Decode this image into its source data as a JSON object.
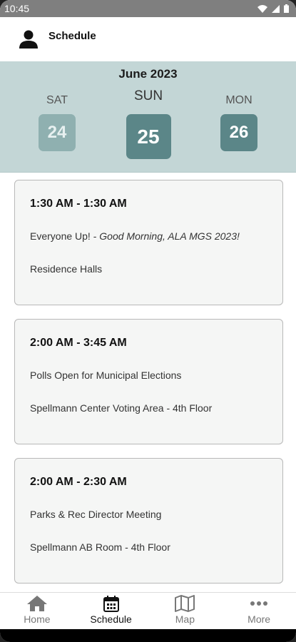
{
  "status": {
    "time": "10:45"
  },
  "header": {
    "title": "Schedule"
  },
  "dates": {
    "month": "June 2023",
    "days": [
      {
        "name": "SAT",
        "num": "24"
      },
      {
        "name": "SUN",
        "num": "25"
      },
      {
        "name": "MON",
        "num": "26"
      }
    ]
  },
  "events": [
    {
      "time": "1:30 AM - 1:30 AM",
      "name_prefix": "Everyone Up! - ",
      "name_italic": "Good Morning, ALA MGS 2023!",
      "location": "Residence Halls"
    },
    {
      "time": "2:00 AM - 3:45 AM",
      "name_prefix": "Polls Open for Municipal Elections",
      "name_italic": "",
      "location": "Spellmann Center Voting Area - 4th Floor"
    },
    {
      "time": "2:00 AM - 2:30 AM",
      "name_prefix": "Parks & Rec Director Meeting",
      "name_italic": "",
      "location": "Spellmann AB Room - 4th Floor"
    }
  ],
  "nav": {
    "items": [
      {
        "label": "Home",
        "icon": "home-icon"
      },
      {
        "label": "Schedule",
        "icon": "calendar-icon"
      },
      {
        "label": "Map",
        "icon": "map-icon"
      },
      {
        "label": "More",
        "icon": "more-icon"
      }
    ],
    "active": "Schedule"
  },
  "colors": {
    "accent": "#5b8688",
    "datebar": "#c3d6d6",
    "inactive_day": "#8fb0b0"
  }
}
